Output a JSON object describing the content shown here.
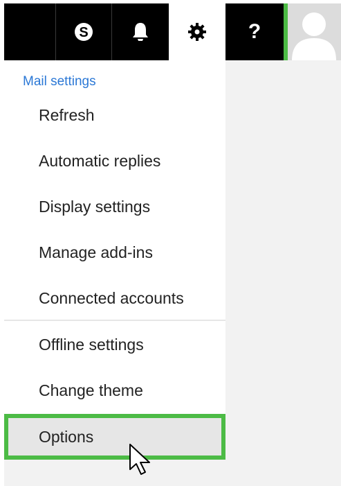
{
  "topbar": {
    "buttons": [
      {
        "name": "blank",
        "icon": ""
      },
      {
        "name": "skype",
        "icon": "skype-icon"
      },
      {
        "name": "notifications",
        "icon": "bell-icon"
      },
      {
        "name": "settings",
        "icon": "gear-icon",
        "active": true
      },
      {
        "name": "help",
        "icon": "question-icon",
        "label": "?"
      }
    ],
    "highlight_color": "#4cbb45"
  },
  "menu": {
    "header": "Mail settings",
    "items": [
      {
        "label": "Refresh"
      },
      {
        "label": "Automatic replies"
      },
      {
        "label": "Display settings"
      },
      {
        "label": "Manage add-ins"
      },
      {
        "label": "Connected accounts"
      },
      {
        "label": "Offline settings"
      },
      {
        "label": "Change theme"
      },
      {
        "label": "Options",
        "selected": true
      }
    ]
  },
  "colors": {
    "accent_link": "#2b78d6",
    "highlight_border": "#4cbb45",
    "topbar_bg": "#000000"
  }
}
